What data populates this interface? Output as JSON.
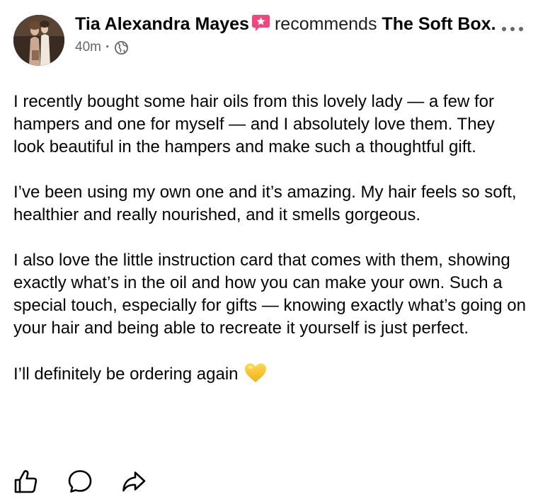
{
  "post": {
    "author": "Tia Alexandra Mayes",
    "action": "recommends",
    "page": "The Soft Box.",
    "timestamp": "40m",
    "separator": "·",
    "audience_icon": "globe-icon",
    "paragraphs": [
      "I recently bought some hair oils from this lovely lady — a few for hampers and one for myself — and I absolutely love them. They look beautiful in the hampers and make such a thoughtful gift.",
      "I’ve been using my own one and it’s amazing. My hair feels so soft, healthier and really nourished, and it smells gorgeous.",
      "I also love the little instruction card that comes with them, showing exactly what’s in the oil and how you can make your own. Such a special touch, especially for gifts — knowing exactly what’s going on your hair and being able to recreate it yourself is just perfect."
    ],
    "closing": "I’ll definitely be ordering again",
    "closing_emoji": "yellow-heart"
  },
  "icons": {
    "recommendation_badge": "recommend-star-icon",
    "more": "more-dots-icon",
    "like": "thumbs-up-icon",
    "comment": "comment-bubble-icon",
    "share": "share-arrow-icon"
  },
  "colors": {
    "text": "#050505",
    "meta": "#65676b",
    "badge": "#f0487a",
    "heart": "#f7c531",
    "icon": "#050505"
  }
}
